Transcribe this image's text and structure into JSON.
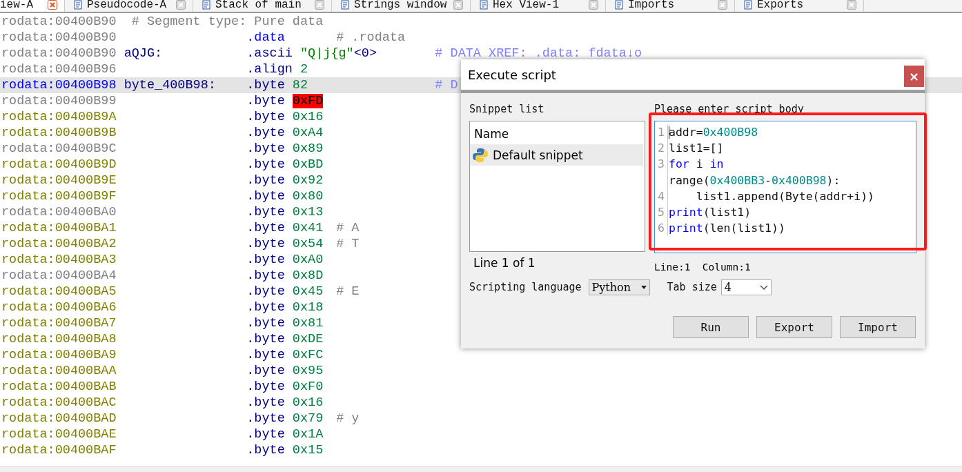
{
  "tabs": [
    {
      "label": "iew-A",
      "selected": true
    },
    {
      "label": "Pseudocode-A",
      "selected": false
    },
    {
      "label": "Stack of main",
      "selected": false
    },
    {
      "label": "Strings window",
      "selected": false
    },
    {
      "label": "Hex View-1",
      "selected": false
    },
    {
      "label": "Imports",
      "selected": false
    },
    {
      "label": "Exports",
      "selected": false
    }
  ],
  "listing": [
    {
      "kind": "comment",
      "address": "rodata:00400B90",
      "color": "#808080",
      "selected": false,
      "comment": "# Segment type: Pure data"
    },
    {
      "kind": "segment",
      "address": "rodata:00400B90",
      "color": "#808080",
      "selected": false,
      "directive": ".data",
      "comment": "# .rodata"
    },
    {
      "kind": "data",
      "address": "rodata:00400B90",
      "color": "#808080",
      "selected": false,
      "label": "aQJG:",
      "directive": ".ascii",
      "operand": [
        {
          "text": "\"Q|j{g\"",
          "kind": "string"
        },
        {
          "text": "<0>",
          "kind": "plain"
        }
      ],
      "comment": "# DATA XREF: .data: fdata↓o",
      "xref": true
    },
    {
      "kind": "data",
      "address": "rodata:00400B96",
      "color": "#808080",
      "selected": false,
      "directive": ".align",
      "operand": [
        {
          "text": "2",
          "kind": "number"
        }
      ]
    },
    {
      "kind": "data",
      "address": "rodata:00400B98",
      "color": "#0000ff",
      "selected": true,
      "label": "byte_400B98:",
      "directive": ".byte",
      "operand": [
        {
          "text": "82",
          "kind": "number"
        }
      ],
      "comment": "# D",
      "xref": true
    },
    {
      "kind": "data",
      "address": "rodata:00400B99",
      "color": "#808080",
      "selected": false,
      "directive": ".byte",
      "operand": [
        {
          "text": "0xFD",
          "kind": "number"
        }
      ],
      "highlighted": true
    },
    {
      "kind": "data",
      "address": "rodata:00400B9A",
      "color": "#808000",
      "selected": false,
      "directive": ".byte",
      "operand": [
        {
          "text": "0x16",
          "kind": "number"
        }
      ]
    },
    {
      "kind": "data",
      "address": "rodata:00400B9B",
      "color": "#808000",
      "selected": false,
      "directive": ".byte",
      "operand": [
        {
          "text": "0xA4",
          "kind": "number"
        }
      ]
    },
    {
      "kind": "data",
      "address": "rodata:00400B9C",
      "color": "#808080",
      "selected": false,
      "directive": ".byte",
      "operand": [
        {
          "text": "0x89",
          "kind": "number"
        }
      ]
    },
    {
      "kind": "data",
      "address": "rodata:00400B9D",
      "color": "#808000",
      "selected": false,
      "directive": ".byte",
      "operand": [
        {
          "text": "0xBD",
          "kind": "number"
        }
      ]
    },
    {
      "kind": "data",
      "address": "rodata:00400B9E",
      "color": "#808000",
      "selected": false,
      "directive": ".byte",
      "operand": [
        {
          "text": "0x92",
          "kind": "number"
        }
      ]
    },
    {
      "kind": "data",
      "address": "rodata:00400B9F",
      "color": "#808000",
      "selected": false,
      "directive": ".byte",
      "operand": [
        {
          "text": "0x80",
          "kind": "number"
        }
      ]
    },
    {
      "kind": "data",
      "address": "rodata:00400BA0",
      "color": "#808080",
      "selected": false,
      "directive": ".byte",
      "operand": [
        {
          "text": "0x13",
          "kind": "number"
        }
      ]
    },
    {
      "kind": "data",
      "address": "rodata:00400BA1",
      "color": "#808000",
      "selected": false,
      "directive": ".byte",
      "operand": [
        {
          "text": "0x41",
          "kind": "number"
        }
      ],
      "comment": "# A"
    },
    {
      "kind": "data",
      "address": "rodata:00400BA2",
      "color": "#808000",
      "selected": false,
      "directive": ".byte",
      "operand": [
        {
          "text": "0x54",
          "kind": "number"
        }
      ],
      "comment": "# T"
    },
    {
      "kind": "data",
      "address": "rodata:00400BA3",
      "color": "#808000",
      "selected": false,
      "directive": ".byte",
      "operand": [
        {
          "text": "0xA0",
          "kind": "number"
        }
      ]
    },
    {
      "kind": "data",
      "address": "rodata:00400BA4",
      "color": "#808080",
      "selected": false,
      "directive": ".byte",
      "operand": [
        {
          "text": "0x8D",
          "kind": "number"
        }
      ]
    },
    {
      "kind": "data",
      "address": "rodata:00400BA5",
      "color": "#808000",
      "selected": false,
      "directive": ".byte",
      "operand": [
        {
          "text": "0x45",
          "kind": "number"
        }
      ],
      "comment": "# E"
    },
    {
      "kind": "data",
      "address": "rodata:00400BA6",
      "color": "#808000",
      "selected": false,
      "directive": ".byte",
      "operand": [
        {
          "text": "0x18",
          "kind": "number"
        }
      ]
    },
    {
      "kind": "data",
      "address": "rodata:00400BA7",
      "color": "#808000",
      "selected": false,
      "directive": ".byte",
      "operand": [
        {
          "text": "0x81",
          "kind": "number"
        }
      ]
    },
    {
      "kind": "data",
      "address": "rodata:00400BA8",
      "color": "#808000",
      "selected": false,
      "directive": ".byte",
      "operand": [
        {
          "text": "0xDE",
          "kind": "number"
        }
      ]
    },
    {
      "kind": "data",
      "address": "rodata:00400BA9",
      "color": "#808000",
      "selected": false,
      "directive": ".byte",
      "operand": [
        {
          "text": "0xFC",
          "kind": "number"
        }
      ]
    },
    {
      "kind": "data",
      "address": "rodata:00400BAA",
      "color": "#808000",
      "selected": false,
      "directive": ".byte",
      "operand": [
        {
          "text": "0x95",
          "kind": "number"
        }
      ]
    },
    {
      "kind": "data",
      "address": "rodata:00400BAB",
      "color": "#808000",
      "selected": false,
      "directive": ".byte",
      "operand": [
        {
          "text": "0xF0",
          "kind": "number"
        }
      ]
    },
    {
      "kind": "data",
      "address": "rodata:00400BAC",
      "color": "#808000",
      "selected": false,
      "directive": ".byte",
      "operand": [
        {
          "text": "0x16",
          "kind": "number"
        }
      ]
    },
    {
      "kind": "data",
      "address": "rodata:00400BAD",
      "color": "#808000",
      "selected": false,
      "directive": ".byte",
      "operand": [
        {
          "text": "0x79",
          "kind": "number"
        }
      ],
      "comment": "# y"
    },
    {
      "kind": "data",
      "address": "rodata:00400BAE",
      "color": "#808000",
      "selected": false,
      "directive": ".byte",
      "operand": [
        {
          "text": "0x1A",
          "kind": "number"
        }
      ]
    },
    {
      "kind": "data",
      "address": "rodata:00400BAF",
      "color": "#808000",
      "selected": false,
      "directive": ".byte",
      "operand": [
        {
          "text": "0x15",
          "kind": "number"
        }
      ]
    }
  ],
  "dialog": {
    "title": "Execute script",
    "close": "×",
    "snippet_label": "Snippet list",
    "snippet_header": "Name",
    "snippets": [
      {
        "label": "Default snippet",
        "selected": true
      }
    ],
    "snippet_status": "Line 1 of 1",
    "script_label": "Please enter script body",
    "code": [
      {
        "number": "1",
        "tokens": [
          {
            "text": "addr=",
            "kind": "plain"
          },
          {
            "text": "0x400B98",
            "kind": "number"
          }
        ]
      },
      {
        "number": "2",
        "tokens": [
          {
            "text": "list1=[]",
            "kind": "plain"
          }
        ]
      },
      {
        "number": "3",
        "tokens": [
          {
            "text": "for",
            "kind": "keyword"
          },
          {
            "text": " i ",
            "kind": "plain"
          },
          {
            "text": "in",
            "kind": "keyword"
          }
        ]
      },
      {
        "tokens": [
          {
            "text": "range(",
            "kind": "plain"
          },
          {
            "text": "0x400BB3",
            "kind": "number"
          },
          {
            "text": "-",
            "kind": "plain"
          },
          {
            "text": "0x400B98",
            "kind": "number"
          },
          {
            "text": "):",
            "kind": "plain"
          }
        ]
      },
      {
        "number": "4",
        "tokens": [
          {
            "text": "    list1.append(Byte(addr+i))",
            "kind": "plain"
          }
        ]
      },
      {
        "number": "5",
        "tokens": [
          {
            "text": "print",
            "kind": "keyword"
          },
          {
            "text": "(list1)",
            "kind": "plain"
          }
        ]
      },
      {
        "number": "6",
        "tokens": [
          {
            "text": "print",
            "kind": "keyword"
          },
          {
            "text": "(len(list1))",
            "kind": "plain"
          }
        ]
      }
    ],
    "cursor_status": "Line:1  Column:1",
    "language_label": "Scripting language",
    "language": "Python",
    "tab_size_label": "Tab size",
    "tab_size": "4",
    "buttons": [
      "Run",
      "Export",
      "Import"
    ]
  }
}
